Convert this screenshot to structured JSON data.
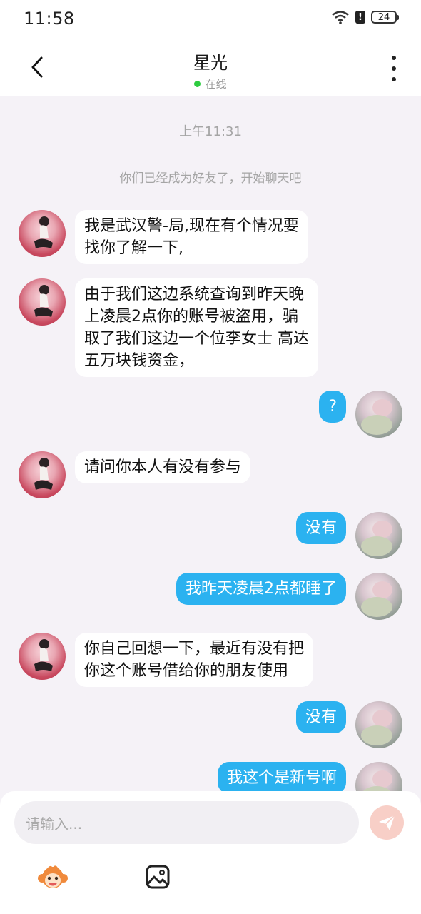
{
  "status_bar": {
    "time": "11:58",
    "battery": "24"
  },
  "header": {
    "title": "星光",
    "status": "在线"
  },
  "chat": {
    "timestamp": "上午11:31",
    "system_note": "你们已经成为好友了，开始聊天吧",
    "messages": [
      {
        "side": "left",
        "line1": "我是武汉警-局,现在有个情况要",
        "line2": "找你了解一下,",
        "line3": "",
        "line4": ""
      },
      {
        "side": "left",
        "line1": "由于我们这边系统查询到昨天晚",
        "line2": "上凌晨2点你的账号被盗用，骗",
        "line3": "取了我们这边一个位李女士 高达",
        "line4": "五万块钱资金，"
      },
      {
        "side": "right",
        "line1": "?"
      },
      {
        "side": "left",
        "line1": "请问你本人有没有参与"
      },
      {
        "side": "right",
        "line1": "没有"
      },
      {
        "side": "right",
        "line1": "我昨天凌晨2点都睡了"
      },
      {
        "side": "left",
        "line1": "你自己回想一下，最近有没有把",
        "line2": "你这个账号借给你的朋友使用"
      },
      {
        "side": "right",
        "line1": "没有"
      },
      {
        "side": "right",
        "line1": "我这个是新号啊"
      }
    ]
  },
  "composer": {
    "placeholder": "请输入..."
  },
  "colors": {
    "outgoing_bubble": "#2bb2f0",
    "incoming_bubble": "#ffffff",
    "online_dot": "#2ecc40",
    "send_button": "#f8cfc7"
  },
  "icons": {
    "back": "chevron-left-icon",
    "more": "more-vertical-icon",
    "send": "send-icon",
    "sticker": "monkey-sticker-icon",
    "image": "image-icon"
  }
}
